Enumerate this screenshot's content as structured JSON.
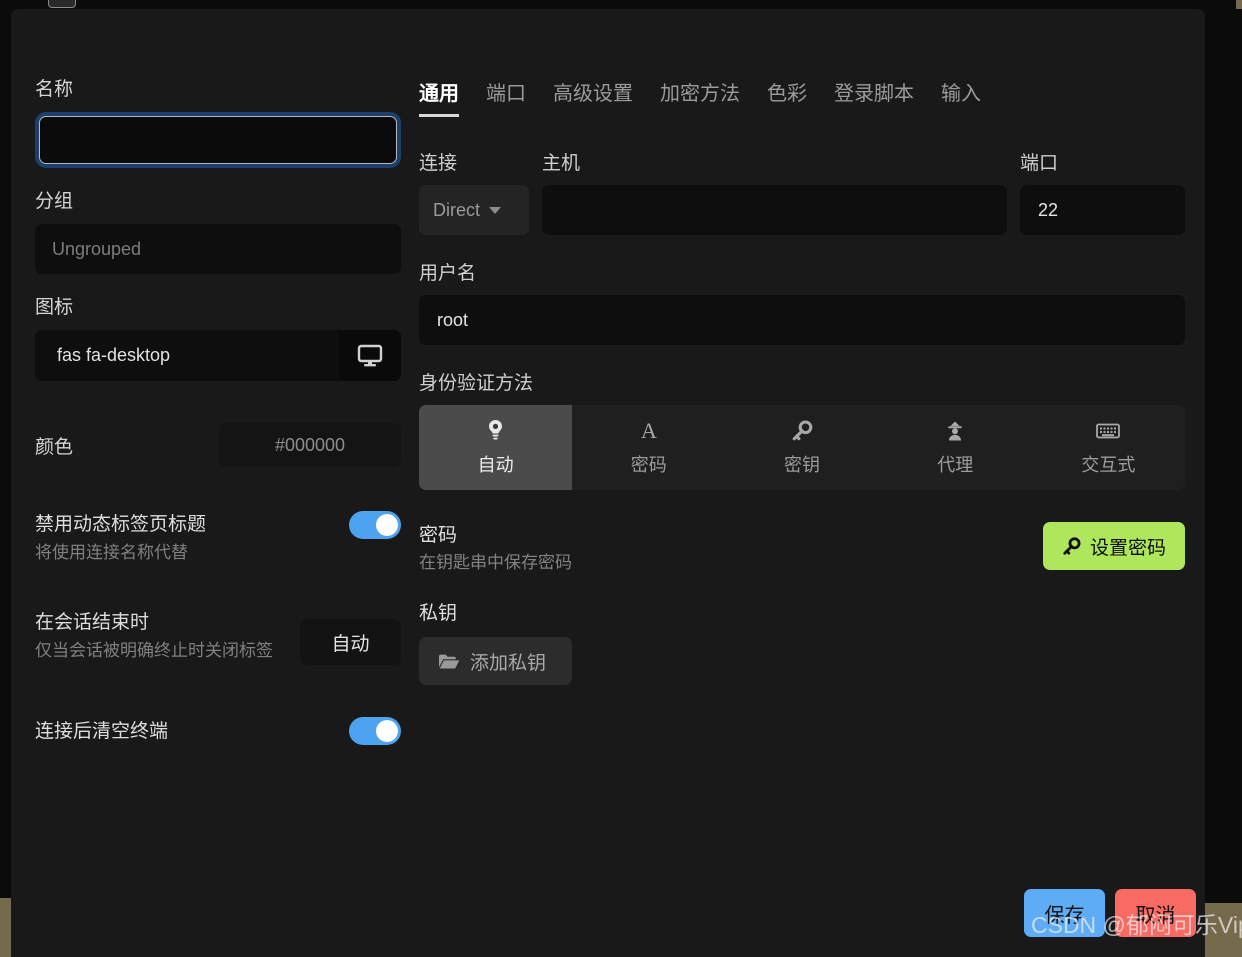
{
  "left": {
    "name": {
      "label": "名称",
      "value": "",
      "placeholder": ""
    },
    "group": {
      "label": "分组",
      "value": "Ungrouped"
    },
    "icon": {
      "label": "图标",
      "value": "fas fa-desktop",
      "preview_icon": "desktop-icon"
    },
    "color": {
      "label": "颜色",
      "value": "#000000"
    },
    "disable_dynamic_title": {
      "title": "禁用动态标签页标题",
      "sub": "将使用连接名称代替",
      "toggle_state": "on"
    },
    "on_session_end": {
      "title": "在会话结束时",
      "sub": "仅当会话被明确终止时关闭标签",
      "value": "自动"
    },
    "clear_terminal": {
      "title": "连接后清空终端",
      "toggle_state": "on"
    }
  },
  "right": {
    "tabs": [
      {
        "label": "通用",
        "active": true
      },
      {
        "label": "端口",
        "active": false
      },
      {
        "label": "高级设置",
        "active": false
      },
      {
        "label": "加密方法",
        "active": false
      },
      {
        "label": "色彩",
        "active": false
      },
      {
        "label": "登录脚本",
        "active": false
      },
      {
        "label": "输入",
        "active": false
      }
    ],
    "connection": {
      "label": "连接",
      "value": "Direct"
    },
    "host": {
      "label": "主机",
      "value": ""
    },
    "port": {
      "label": "端口",
      "value": "22"
    },
    "username": {
      "label": "用户名",
      "value": "root"
    },
    "auth": {
      "label": "身份验证方法",
      "options": [
        {
          "label": "自动",
          "icon": "lightbulb-icon",
          "active": true
        },
        {
          "label": "密码",
          "icon": "letter-a-icon",
          "active": false
        },
        {
          "label": "密钥",
          "icon": "key-icon",
          "active": false
        },
        {
          "label": "代理",
          "icon": "user-secret-icon",
          "active": false
        },
        {
          "label": "交互式",
          "icon": "keyboard-icon",
          "active": false
        }
      ]
    },
    "password": {
      "title": "密码",
      "sub": "在钥匙串中保存密码",
      "button_label": "设置密码",
      "button_icon": "key-icon",
      "button_color": "#aee65c"
    },
    "private_key": {
      "label": "私钥",
      "button_label": "添加私钥",
      "button_icon": "folder-open-icon"
    }
  },
  "footer": {
    "save_label": "保存",
    "cancel_label": "取消",
    "save_color": "#5dacf5",
    "cancel_color": "#f96a62"
  },
  "watermark": {
    "text": "CSDN @郁闷可乐Vip"
  }
}
